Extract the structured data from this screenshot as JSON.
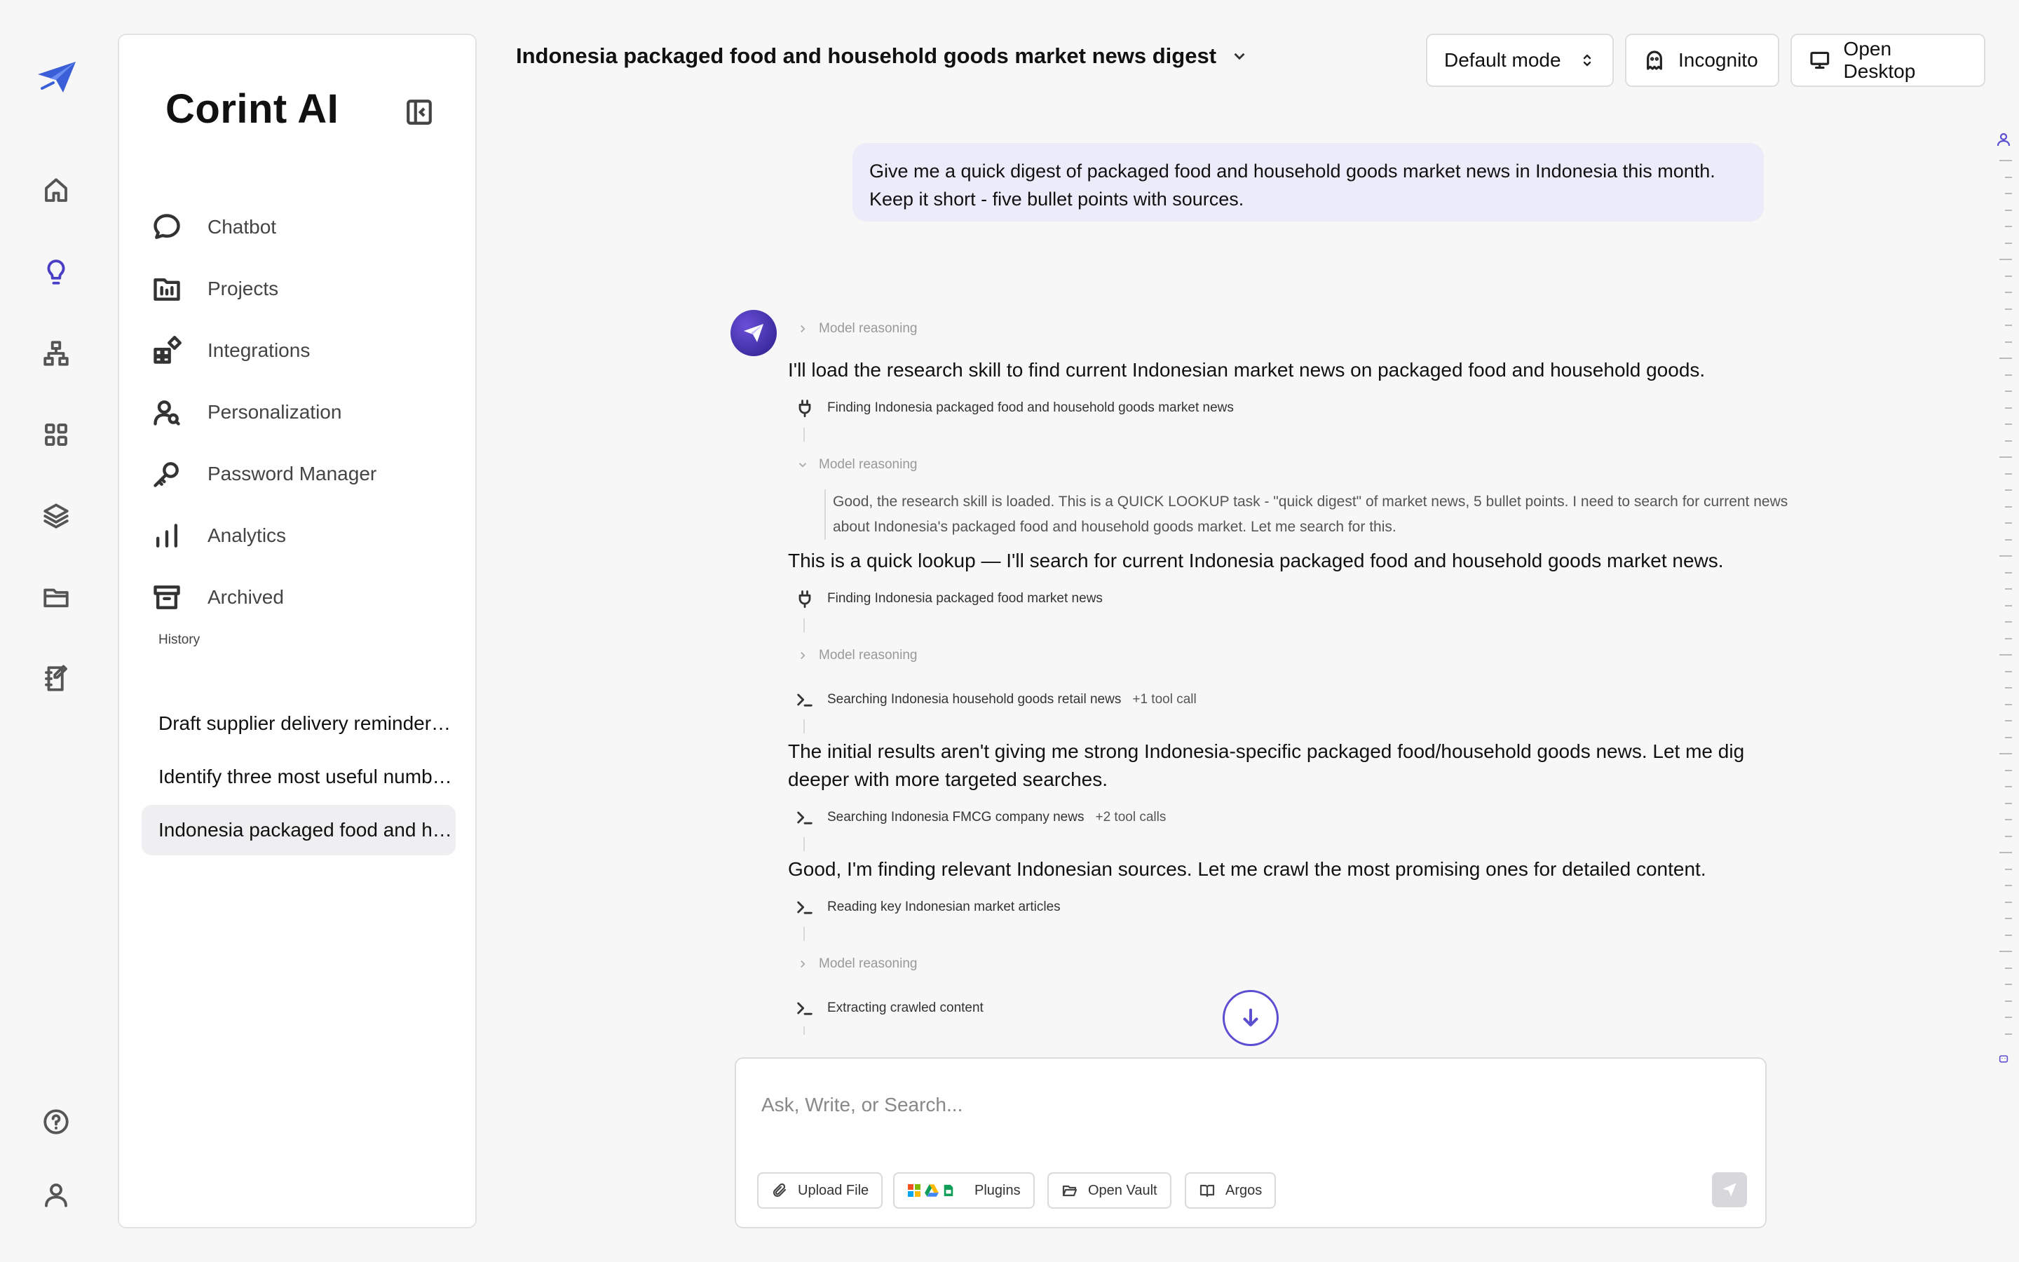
{
  "app": {
    "brand": "Corint AI"
  },
  "rail": {
    "items": [
      {
        "name": "home-icon"
      },
      {
        "name": "lightbulb-icon"
      },
      {
        "name": "sitemap-icon"
      },
      {
        "name": "grid-icon"
      },
      {
        "name": "layers-icon"
      },
      {
        "name": "folder-icon"
      },
      {
        "name": "notebook-icon"
      }
    ],
    "help": "help-icon",
    "user": "user-icon"
  },
  "sidebar": {
    "items": [
      {
        "label": "Chatbot",
        "icon": "chat-bubble-icon"
      },
      {
        "label": "Projects",
        "icon": "projects-icon"
      },
      {
        "label": "Integrations",
        "icon": "integrations-icon"
      },
      {
        "label": "Personalization",
        "icon": "personalization-icon"
      },
      {
        "label": "Password Manager",
        "icon": "key-icon"
      },
      {
        "label": "Analytics",
        "icon": "bar-chart-icon"
      },
      {
        "label": "Archived",
        "icon": "archive-icon"
      }
    ],
    "history_title": "History",
    "history": [
      {
        "label": "Draft supplier delivery reminder email",
        "active": false
      },
      {
        "label": "Identify three most useful number formats",
        "active": false
      },
      {
        "label": "Indonesia packaged food and household goods market news digest",
        "active": true
      }
    ]
  },
  "header": {
    "title": "Indonesia packaged food and household goods market news digest",
    "mode_label": "Default mode",
    "incognito_label": "Incognito",
    "open_desktop_label": "Open Desktop"
  },
  "conversation": {
    "user_message": "Give me a quick digest of packaged food and household goods market news in Indonesia this month. Keep it short - five bullet points with sources.",
    "steps": {
      "reasoning_label": "Model reasoning",
      "text1": "I'll load the research skill to find current Indonesian market news on packaged food and household goods.",
      "tool1": "Finding Indonesia packaged food and household goods market news",
      "reasoning_body": "Good, the research skill is loaded. This is a QUICK LOOKUP task - \"quick digest\" of market news, 5 bullet points. I need to search for current news about Indonesia's packaged food and household goods market. Let me search for this.",
      "text2": "This is a quick lookup — I'll search for current Indonesia packaged food and household goods market news.",
      "tool2": "Finding Indonesia packaged food market news",
      "tool3": "Searching Indonesia household goods retail news",
      "tool3_extra": "+1 tool call",
      "text3": "The initial results aren't giving me strong Indonesia-specific packaged food/household goods news. Let me dig deeper with more targeted searches.",
      "tool4": "Searching Indonesia FMCG company news",
      "tool4_extra": "+2 tool calls",
      "text4": "Good, I'm finding relevant Indonesian sources. Let me crawl the most promising ones for detailed content.",
      "tool5": "Reading key Indonesian market articles",
      "tool6": "Extracting crawled content"
    }
  },
  "composer": {
    "placeholder": "Ask, Write, or Search...",
    "upload_label": "Upload File",
    "plugins_label": "Plugins",
    "vault_label": "Open Vault",
    "argos_label": "Argos"
  },
  "colors": {
    "accent": "#5b4ed1",
    "user_bubble": "#ecebfa",
    "active_history": "#efeff1"
  }
}
